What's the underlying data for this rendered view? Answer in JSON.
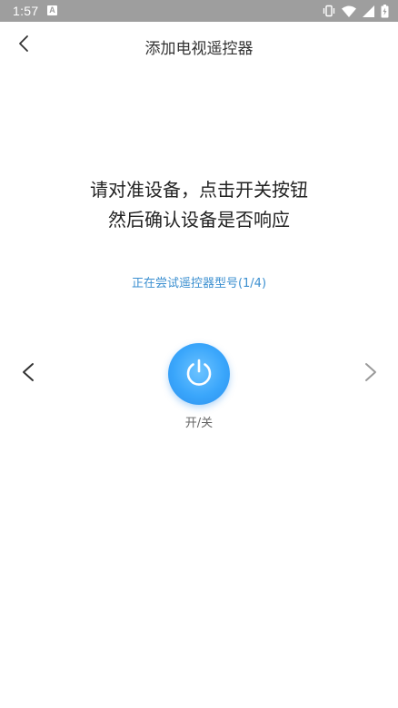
{
  "status_bar": {
    "time": "1:57",
    "notification_glyph": "A",
    "icons": [
      "vibrate-icon",
      "wifi-icon",
      "signal-icon",
      "battery-icon"
    ]
  },
  "header": {
    "title": "添加电视遥控器",
    "back_icon": "chevron-left-icon"
  },
  "instruction": {
    "line1": "请对准设备，点击开关按钮",
    "line2": "然后确认设备是否响应"
  },
  "progress_text": "正在尝试遥控器型号(1/4)",
  "remote_key": {
    "label": "开/关",
    "icon": "power-icon"
  },
  "nav": {
    "prev_icon": "chevron-left-icon",
    "next_icon": "chevron-right-icon"
  },
  "colors": {
    "status_bar": "#9e9e9e",
    "accent": "#3b8fd0",
    "power_button": "#3aa6fb"
  }
}
